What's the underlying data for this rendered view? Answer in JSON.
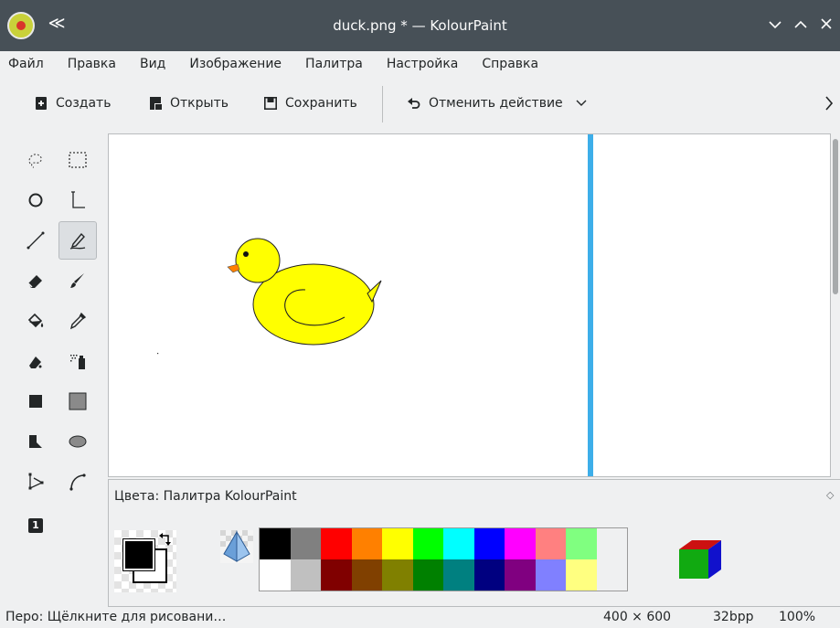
{
  "window": {
    "title": "duck.png * — KolourPaint",
    "buttons": [
      "minimize",
      "maximize",
      "close"
    ]
  },
  "menubar": {
    "items": [
      "Файл",
      "Правка",
      "Вид",
      "Изображение",
      "Палитра",
      "Настройка",
      "Справка"
    ]
  },
  "toolbar": {
    "new_label": "Создать",
    "open_label": "Открыть",
    "save_label": "Сохранить",
    "undo_label": "Отменить действие"
  },
  "toolbox": {
    "tools": [
      {
        "name": "free-form-selection",
        "selected": false
      },
      {
        "name": "rectangular-selection",
        "selected": false
      },
      {
        "name": "zoom",
        "selected": false
      },
      {
        "name": "text",
        "selected": false
      },
      {
        "name": "line",
        "selected": false
      },
      {
        "name": "pen",
        "selected": true
      },
      {
        "name": "eraser",
        "selected": false
      },
      {
        "name": "brush",
        "selected": false
      },
      {
        "name": "flood-fill",
        "selected": false
      },
      {
        "name": "color-picker",
        "selected": false
      },
      {
        "name": "color-eraser",
        "selected": false
      },
      {
        "name": "spraycan",
        "selected": false
      },
      {
        "name": "rectangle",
        "selected": false
      },
      {
        "name": "rounded-rectangle",
        "selected": false
      },
      {
        "name": "polygon",
        "selected": false
      },
      {
        "name": "ellipse",
        "selected": false
      },
      {
        "name": "connected-lines",
        "selected": false
      },
      {
        "name": "curve",
        "selected": false
      },
      {
        "name": "brush-size-option",
        "selected": false
      }
    ],
    "option_badge": "1"
  },
  "colors_dock": {
    "title": "Цвета: Палитра KolourPaint",
    "foreground": "#000000",
    "background": "#ffffff",
    "palette_row1": [
      "#000000",
      "#808080",
      "#ff0000",
      "#ff8000",
      "#ffff00",
      "#00ff00",
      "#00ffff",
      "#0000ff",
      "#ff00ff",
      "#ff8080",
      "#80ff80",
      ""
    ],
    "palette_row2": [
      "#ffffff",
      "#c0c0c0",
      "#800000",
      "#804000",
      "#808000",
      "#008000",
      "#008080",
      "#000080",
      "#800080",
      "#8080ff",
      "#ffff80",
      ""
    ]
  },
  "colors": {
    "accent": "#3daee9",
    "duck_body": "#ffff00",
    "duck_beak": "#ff8000"
  },
  "statusbar": {
    "message": "Перо: Щёлкните для рисовани…",
    "size": "400 × 600",
    "depth": "32bpp",
    "zoom": "100%"
  }
}
